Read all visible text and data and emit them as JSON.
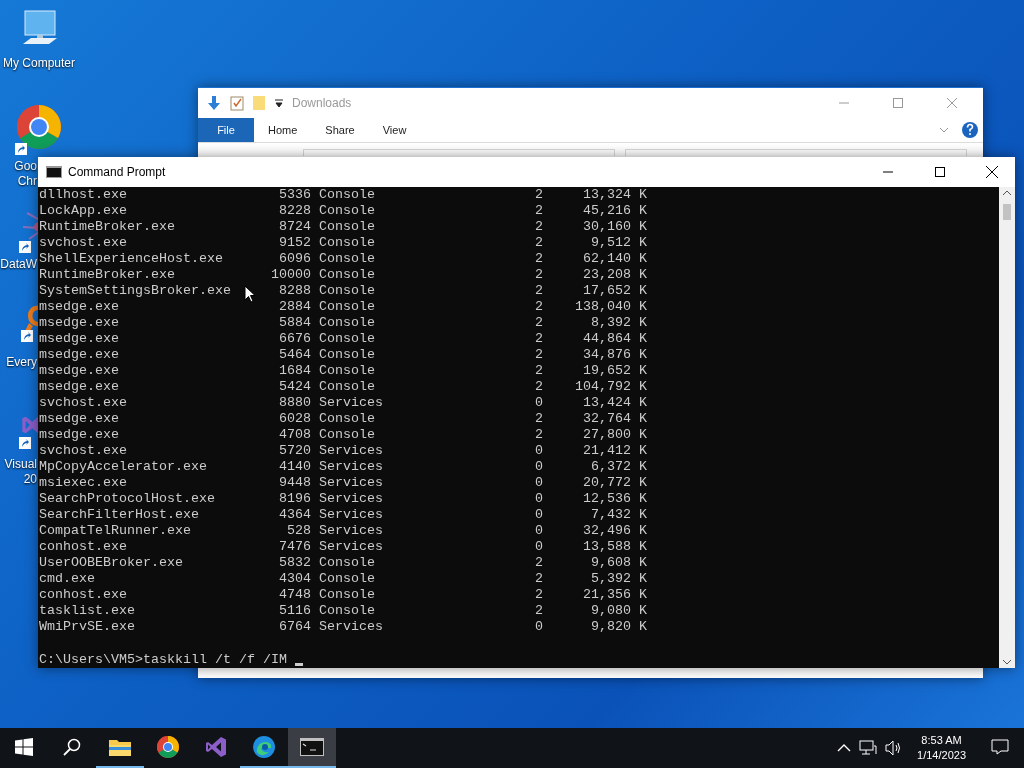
{
  "desktop": {
    "icons": [
      {
        "kind": "computer",
        "label": [
          "My Computer"
        ]
      },
      {
        "kind": "chrome",
        "label": [
          "Goo",
          "Chr"
        ]
      },
      {
        "kind": "molecule",
        "label": [
          "DataW"
        ]
      },
      {
        "kind": "magnifier",
        "label": [
          "Every"
        ]
      },
      {
        "kind": "studio",
        "label": [
          "Visual",
          "20"
        ]
      }
    ]
  },
  "explorer": {
    "title": "Downloads",
    "tabs": [
      {
        "label": "File",
        "selected": true
      },
      {
        "label": "Home",
        "selected": false
      },
      {
        "label": "Share",
        "selected": false
      },
      {
        "label": "View",
        "selected": false
      }
    ]
  },
  "cmd": {
    "title": "Command Prompt",
    "rows": [
      {
        "name": "dllhost.exe",
        "pid": "5336",
        "session": "Console",
        "num": "2",
        "mem": "13,324 K"
      },
      {
        "name": "LockApp.exe",
        "pid": "8228",
        "session": "Console",
        "num": "2",
        "mem": "45,216 K"
      },
      {
        "name": "RuntimeBroker.exe",
        "pid": "8724",
        "session": "Console",
        "num": "2",
        "mem": "30,160 K"
      },
      {
        "name": "svchost.exe",
        "pid": "9152",
        "session": "Console",
        "num": "2",
        "mem": "9,512 K"
      },
      {
        "name": "ShellExperienceHost.exe",
        "pid": "6096",
        "session": "Console",
        "num": "2",
        "mem": "62,140 K"
      },
      {
        "name": "RuntimeBroker.exe",
        "pid": "10000",
        "session": "Console",
        "num": "2",
        "mem": "23,208 K"
      },
      {
        "name": "SystemSettingsBroker.exe",
        "pid": "8288",
        "session": "Console",
        "num": "2",
        "mem": "17,652 K"
      },
      {
        "name": "msedge.exe",
        "pid": "2884",
        "session": "Console",
        "num": "2",
        "mem": "138,040 K"
      },
      {
        "name": "msedge.exe",
        "pid": "5884",
        "session": "Console",
        "num": "2",
        "mem": "8,392 K"
      },
      {
        "name": "msedge.exe",
        "pid": "6676",
        "session": "Console",
        "num": "2",
        "mem": "44,864 K"
      },
      {
        "name": "msedge.exe",
        "pid": "5464",
        "session": "Console",
        "num": "2",
        "mem": "34,876 K"
      },
      {
        "name": "msedge.exe",
        "pid": "1684",
        "session": "Console",
        "num": "2",
        "mem": "19,652 K"
      },
      {
        "name": "msedge.exe",
        "pid": "5424",
        "session": "Console",
        "num": "2",
        "mem": "104,792 K"
      },
      {
        "name": "svchost.exe",
        "pid": "8880",
        "session": "Services",
        "num": "0",
        "mem": "13,424 K"
      },
      {
        "name": "msedge.exe",
        "pid": "6028",
        "session": "Console",
        "num": "2",
        "mem": "32,764 K"
      },
      {
        "name": "msedge.exe",
        "pid": "4708",
        "session": "Console",
        "num": "2",
        "mem": "27,800 K"
      },
      {
        "name": "svchost.exe",
        "pid": "5720",
        "session": "Services",
        "num": "0",
        "mem": "21,412 K"
      },
      {
        "name": "MpCopyAccelerator.exe",
        "pid": "4140",
        "session": "Services",
        "num": "0",
        "mem": "6,372 K"
      },
      {
        "name": "msiexec.exe",
        "pid": "9448",
        "session": "Services",
        "num": "0",
        "mem": "20,772 K"
      },
      {
        "name": "SearchProtocolHost.exe",
        "pid": "8196",
        "session": "Services",
        "num": "0",
        "mem": "12,536 K"
      },
      {
        "name": "SearchFilterHost.exe",
        "pid": "4364",
        "session": "Services",
        "num": "0",
        "mem": "7,432 K"
      },
      {
        "name": "CompatTelRunner.exe",
        "pid": "528",
        "session": "Services",
        "num": "0",
        "mem": "32,496 K"
      },
      {
        "name": "conhost.exe",
        "pid": "7476",
        "session": "Services",
        "num": "0",
        "mem": "13,588 K"
      },
      {
        "name": "UserOOBEBroker.exe",
        "pid": "5832",
        "session": "Console",
        "num": "2",
        "mem": "9,608 K"
      },
      {
        "name": "cmd.exe",
        "pid": "4304",
        "session": "Console",
        "num": "2",
        "mem": "5,392 K"
      },
      {
        "name": "conhost.exe",
        "pid": "4748",
        "session": "Console",
        "num": "2",
        "mem": "21,356 K"
      },
      {
        "name": "tasklist.exe",
        "pid": "5116",
        "session": "Console",
        "num": "2",
        "mem": "9,080 K"
      },
      {
        "name": "WmiPrvSE.exe",
        "pid": "6764",
        "session": "Services",
        "num": "0",
        "mem": "9,820 K"
      }
    ],
    "prompt": "C:\\Users\\VM5>taskkill /t /f /IM"
  },
  "taskbar": {
    "apps": [
      {
        "kind": "folder",
        "running": true,
        "selected": false
      },
      {
        "kind": "chrome",
        "running": false,
        "selected": false
      },
      {
        "kind": "studio",
        "running": false,
        "selected": false
      },
      {
        "kind": "edge",
        "running": true,
        "selected": false
      },
      {
        "kind": "console",
        "running": true,
        "selected": true
      }
    ],
    "time": "8:53 AM",
    "date": "1/14/2023"
  }
}
